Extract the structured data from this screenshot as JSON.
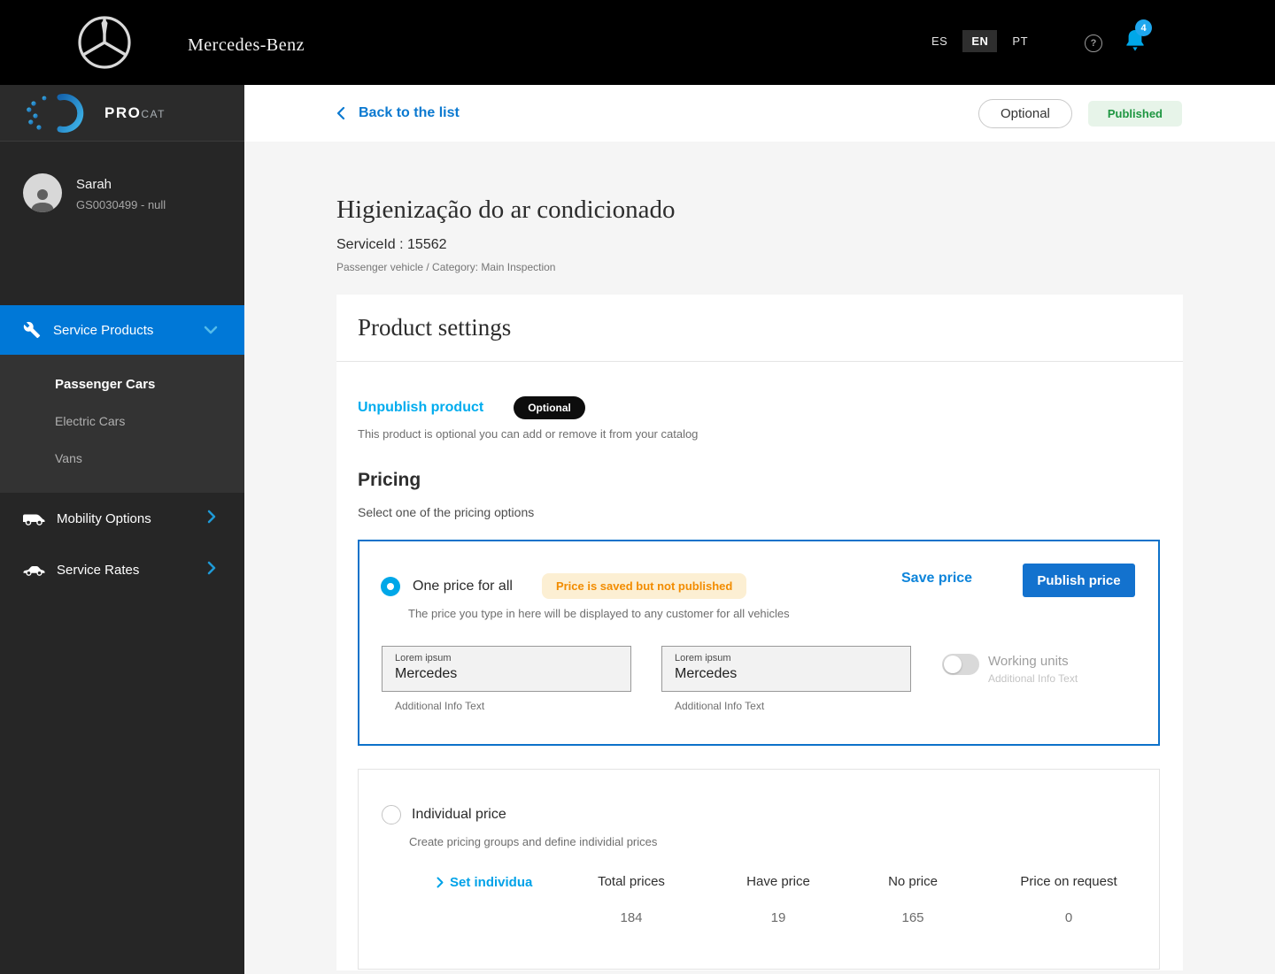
{
  "colors": {
    "brand_blue": "#0078D7",
    "accent_light_blue": "#00A7E8",
    "link_blue": "#0B79D0",
    "publish_blue": "#1372CE",
    "warning_text": "#F28C00",
    "warning_bg": "#FCEFD3",
    "published_text": "#1E9641",
    "published_bg": "#E7F4E9",
    "sidebar_bg": "#262626",
    "topbar_bg": "#000000"
  },
  "topbar": {
    "brand": "Mercedes-Benz",
    "languages": [
      {
        "code": "ES",
        "active": false
      },
      {
        "code": "EN",
        "active": true
      },
      {
        "code": "PT",
        "active": false
      }
    ],
    "help_glyph": "?",
    "notification_count": "4"
  },
  "sidebar": {
    "logo": {
      "pro": "PRO",
      "cat": "CAT"
    },
    "user": {
      "name": "Sarah",
      "id": "GS0030499 - null"
    },
    "nav": {
      "service_products": "Service Products",
      "mobility_options": "Mobility Options",
      "service_rates": "Service Rates"
    },
    "submenu": [
      {
        "label": "Passenger Cars",
        "active": true
      },
      {
        "label": "Electric Cars",
        "active": false
      },
      {
        "label": "Vans",
        "active": false
      }
    ]
  },
  "actionbar": {
    "back": "Back to the list",
    "optional_button": "Optional",
    "published_badge": "Published"
  },
  "page": {
    "title": "Higienização do ar condicionado",
    "service_id": "ServiceId : 15562",
    "category": "Passenger vehicle / Category: Main Inspection"
  },
  "product_settings": {
    "title": "Product settings",
    "unpublish_link": "Unpublish product",
    "optional_badge": "Optional",
    "description": "This product is optional you can add or remove it from your catalog"
  },
  "pricing": {
    "title": "Pricing",
    "subtitle": "Select one of the pricing options",
    "one_price": {
      "label": "One price for all",
      "status_badge": "Price is saved but not published",
      "save_link": "Save price",
      "publish_button": "Publish price",
      "description": "The price you type in here will be displayed to any customer for all vehicles",
      "fields": [
        {
          "label": "Lorem ipsum",
          "value": "Mercedes",
          "helper": "Additional Info Text"
        },
        {
          "label": "Lorem ipsum",
          "value": "Mercedes",
          "helper": "Additional Info Text"
        }
      ],
      "toggle": {
        "label": "Working units",
        "helper": "Additional Info Text",
        "state": "off"
      }
    },
    "individual": {
      "label": "Individual price",
      "description": "Create pricing groups and define individial prices",
      "link": "Set individua",
      "stats": [
        {
          "label": "Total prices",
          "value": "184"
        },
        {
          "label": "Have price",
          "value": "19"
        },
        {
          "label": "No price",
          "value": "165"
        },
        {
          "label": "Price on request",
          "value": "0"
        }
      ]
    }
  }
}
